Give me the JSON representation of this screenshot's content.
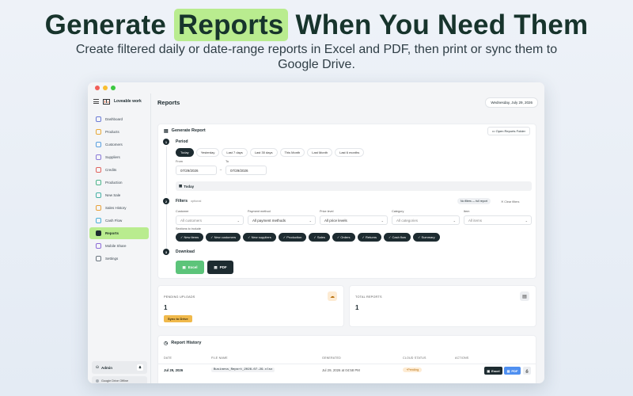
{
  "hero": {
    "title_pre": "Generate",
    "title_highlight": "Reports",
    "title_post": "When You Need Them",
    "subtitle": "Create filtered daily or date-range reports in Excel and PDF, then print or sync them to Google Drive."
  },
  "colors": {
    "accent_green": "#b9ec8f",
    "dark": "#1d2b30",
    "excel_green": "#5cc47a",
    "pdf_blue": "#4f8ff0",
    "sync_yellow": "#f0b94b"
  },
  "app": {
    "name": "Loveable work",
    "page_title": "Reports",
    "date": "Wednesday, July 29, 2026"
  },
  "sidebar": {
    "items": [
      {
        "label": "Dashboard",
        "icon": "grid-icon",
        "color": "#6b7bd6"
      },
      {
        "label": "Products",
        "icon": "box-icon",
        "color": "#e7a93a"
      },
      {
        "label": "Customers",
        "icon": "users-icon",
        "color": "#5aa0e0"
      },
      {
        "label": "Suppliers",
        "icon": "truck-icon",
        "color": "#8a7ad8"
      },
      {
        "label": "Credits",
        "icon": "card-icon",
        "color": "#e0645f"
      },
      {
        "label": "Production",
        "icon": "factory-icon",
        "color": "#4fb58c"
      },
      {
        "label": "New Sale",
        "icon": "cart-icon",
        "color": "#48b1a5"
      },
      {
        "label": "Sales History",
        "icon": "history-icon",
        "color": "#e8a23c"
      },
      {
        "label": "Cash Flow",
        "icon": "wallet-icon",
        "color": "#4cb0d8"
      },
      {
        "label": "Reports",
        "icon": "report-icon",
        "color": "#1d2b30"
      },
      {
        "label": "Mobile Share",
        "icon": "phone-icon",
        "color": "#8d6bd8"
      },
      {
        "label": "Settings",
        "icon": "gear-icon",
        "color": "#6c7780"
      }
    ],
    "active_index": 9,
    "user": "Admin",
    "drive_status": "Google Drive Offline"
  },
  "generate": {
    "title": "Generate Report",
    "open_folder": "Open Reports Folder",
    "step1": {
      "num": "1",
      "title": "Period"
    },
    "period_chips": [
      "Today",
      "Yesterday",
      "Last 7 days",
      "Last 30 days",
      "This Month",
      "Last Month",
      "Last 6 months"
    ],
    "selected_period": "Today",
    "from_label": "From",
    "to_label": "To",
    "from_value": "07/29/2026",
    "to_value": "07/29/2026",
    "range_separator": "→",
    "period_summary": "Today",
    "step2": {
      "num": "2",
      "title": "Filters",
      "optional": "optional"
    },
    "no_filters": "No filters — full report",
    "clear_filters": "Clear filters",
    "filters": [
      {
        "label": "Customer",
        "value": "All customers",
        "placeholder": true
      },
      {
        "label": "Payment method",
        "value": "All payment methods",
        "placeholder": false
      },
      {
        "label": "Price level",
        "value": "All price levels",
        "placeholder": false
      },
      {
        "label": "Category",
        "value": "All categories",
        "placeholder": true
      },
      {
        "label": "Item",
        "value": "All items",
        "placeholder": true
      }
    ],
    "sections_label": "Sections to include",
    "sections": [
      "New items",
      "New customers",
      "New suppliers",
      "Production",
      "Sales",
      "Orders",
      "Returns",
      "Cash flow",
      "Summary"
    ],
    "step3": {
      "num": "3",
      "title": "Download"
    },
    "excel_label": "Excel",
    "pdf_label": "PDF"
  },
  "stats": {
    "pending_label": "PENDING UPLOADS",
    "pending_value": "1",
    "sync_label": "Sync to Drive",
    "total_label": "TOTAL REPORTS",
    "total_value": "1"
  },
  "history": {
    "title": "Report History",
    "columns": [
      "DATE",
      "FILE NAME",
      "GENERATED",
      "CLOUD STATUS",
      "ACTIONS"
    ],
    "rows": [
      {
        "date": "Jul 29, 2026",
        "file": "Business_Report_2026-07-29.xlsx",
        "generated": "Jul 29, 2026 at 04:58 PM",
        "status": "Pending",
        "excel": "Excel",
        "pdf": "PDF"
      }
    ]
  }
}
